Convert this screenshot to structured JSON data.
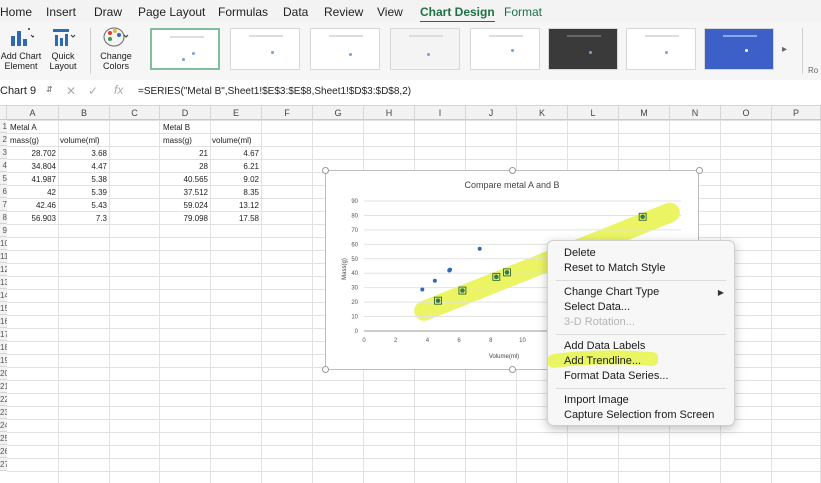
{
  "ribbon_tabs": [
    {
      "label": "Home"
    },
    {
      "label": "Insert"
    },
    {
      "label": "Draw"
    },
    {
      "label": "Page Layout"
    },
    {
      "label": "Formulas"
    },
    {
      "label": "Data"
    },
    {
      "label": "Review"
    },
    {
      "label": "View"
    },
    {
      "label": "Chart Design"
    },
    {
      "label": "Format"
    }
  ],
  "ribbon": {
    "add_chart_element_1": "Add Chart",
    "add_chart_element_2": "Element",
    "quick_layout_1": "Quick",
    "quick_layout_2": "Layout",
    "change_colors_1": "Change",
    "change_colors_2": "Colors",
    "edge_label": "Ro"
  },
  "formula_bar": {
    "name_box": "Chart 9",
    "formula": "=SERIES(\"Metal B\",Sheet1!$E$3:$E$8,Sheet1!$D$3:$D$8,2)"
  },
  "columns": [
    "A",
    "B",
    "C",
    "D",
    "E",
    "F",
    "G",
    "H",
    "I",
    "J",
    "K",
    "L",
    "M",
    "N",
    "O",
    "P"
  ],
  "rows": [
    "1",
    "2",
    "3",
    "4",
    "5",
    "6",
    "7",
    "8",
    "9",
    "10",
    "11",
    "12",
    "13",
    "14",
    "15",
    "16",
    "17",
    "18",
    "19",
    "20",
    "21",
    "22",
    "23",
    "24",
    "25",
    "26",
    "27"
  ],
  "sheet": {
    "metal_a_title": "Metal A",
    "metal_a_headers": [
      "mass(g)",
      "volume(ml)"
    ],
    "metal_a_rows": [
      [
        "28.702",
        "3.68"
      ],
      [
        "34.804",
        "4.47"
      ],
      [
        "41.987",
        "5.38"
      ],
      [
        "42",
        "5.39"
      ],
      [
        "42.46",
        "5.43"
      ],
      [
        "56.903",
        "7.3"
      ]
    ],
    "metal_b_title": "Metal B",
    "metal_b_headers": [
      "mass(g)",
      "volume(ml)"
    ],
    "metal_b_rows": [
      [
        "21",
        "4.67"
      ],
      [
        "28",
        "6.21"
      ],
      [
        "40.565",
        "9.02"
      ],
      [
        "37.512",
        "8.35"
      ],
      [
        "59.024",
        "13.12"
      ],
      [
        "79.098",
        "17.58"
      ]
    ]
  },
  "chart_data": {
    "type": "scatter",
    "title": "Compare metal A and B",
    "xlabel": "Volume(ml)",
    "ylabel": "Mass(g)",
    "xlim": [
      0,
      20
    ],
    "ylim": [
      0,
      90
    ],
    "xticks": [
      "0",
      "2",
      "4",
      "6",
      "8",
      "10",
      "12",
      "14"
    ],
    "yticks": [
      "0",
      "10",
      "20",
      "30",
      "40",
      "50",
      "60",
      "70",
      "80",
      "90"
    ],
    "grid": true,
    "series": [
      {
        "x": [
          3.68,
          4.47,
          5.38,
          5.39,
          5.43,
          7.3
        ],
        "y": [
          28.702,
          34.804,
          41.987,
          42,
          42.46,
          56.903
        ],
        "color": "#2e6ab4"
      },
      {
        "x": [
          4.67,
          6.21,
          9.02,
          8.35,
          13.12,
          17.58
        ],
        "y": [
          21,
          28,
          40.565,
          37.512,
          59.024,
          79.098
        ],
        "color": "#2e7d4e"
      }
    ]
  },
  "context_menu": {
    "items": [
      {
        "label": "Delete"
      },
      {
        "label": "Reset to Match Style"
      },
      {
        "label": "Change Chart Type"
      },
      {
        "label": "Select Data..."
      },
      {
        "label": "3-D Rotation..."
      },
      {
        "label": "Add Data Labels"
      },
      {
        "label": "Add Trendline..."
      },
      {
        "label": "Format Data Series..."
      },
      {
        "label": "Import Image"
      },
      {
        "label": "Capture Selection from Screen"
      }
    ]
  },
  "colors": {
    "accent": "#1e7145",
    "highlight": "#e8f44a"
  }
}
